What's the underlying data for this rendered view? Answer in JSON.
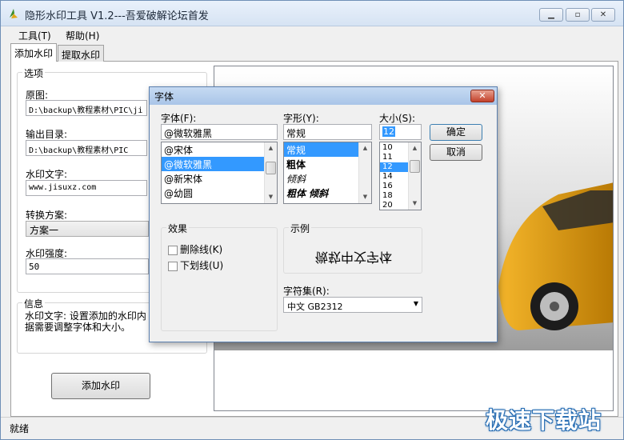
{
  "window": {
    "title": "隐形水印工具 V1.2---吾爱破解论坛首发",
    "minimize_glyph": "▁",
    "maximize_glyph": "▫",
    "close_glyph": "✕"
  },
  "menu": [
    "工具(T)",
    "帮助(H)"
  ],
  "tabs": [
    "添加水印",
    "提取水印"
  ],
  "options": {
    "group_title": "选项",
    "source_label": "原图:",
    "source_value": "D:\\backup\\教程素材\\PIC\\ji",
    "output_label": "输出目录:",
    "output_value": "D:\\backup\\教程素材\\PIC",
    "watermark_text_label": "水印文字:",
    "watermark_text_value": "www.jisuxz.com",
    "scheme_label": "转换方案:",
    "scheme_value": "方案一",
    "strength_label": "水印强度:",
    "strength_value": "50"
  },
  "info": {
    "group_title": "信息",
    "line1": "水印文字: 设置添加的水印内",
    "line2": "据需要调整字体和大小。"
  },
  "add_button": "添加水印",
  "status": "就绪",
  "watermark": "极速下载站",
  "font_dialog": {
    "title": "字体",
    "close_glyph": "✕",
    "font_label": "字体(F):",
    "font_value": "@微软雅黑",
    "font_list": [
      "@宋体",
      "@微软雅黑",
      "@新宋体",
      "@幼圆"
    ],
    "style_label": "字形(Y):",
    "style_value": "常规",
    "style_list": [
      "常规",
      "粗体",
      "倾斜",
      "粗体 倾斜"
    ],
    "size_label": "大小(S):",
    "size_value": "12",
    "size_list": [
      "10",
      "11",
      "12",
      "14",
      "16",
      "18",
      "20"
    ],
    "ok_button": "确定",
    "cancel_button": "取消",
    "effects_title": "效果",
    "strikeout_label": "删除线(K)",
    "underline_label": "下划线(U)",
    "sample_title": "示例",
    "sample_text": "微软中文字体",
    "charset_label": "字符集(R):",
    "charset_value": "中文 GB2312"
  },
  "colors": {
    "selection": "#3399ff",
    "car_body": "#e8a30f"
  },
  "icons": [
    "app-icon",
    "dropdown-arrow-icon",
    "scroll-up-icon",
    "scroll-down-icon"
  ]
}
